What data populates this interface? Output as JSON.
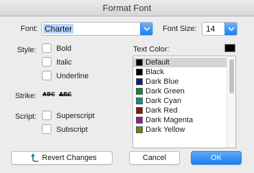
{
  "window": {
    "title": "Format Font"
  },
  "font": {
    "label": "Font:",
    "value": "Charter"
  },
  "font_size": {
    "label": "Font Size:",
    "value": "14"
  },
  "style": {
    "label": "Style:",
    "options": [
      {
        "label": "Bold",
        "checked": false
      },
      {
        "label": "Italic",
        "checked": false
      },
      {
        "label": "Underline",
        "checked": false
      }
    ]
  },
  "strike": {
    "label": "Strike:",
    "single_text": "ABC",
    "double_text": "ABC"
  },
  "script": {
    "label": "Script:",
    "options": [
      {
        "label": "Superscript",
        "checked": false
      },
      {
        "label": "Subscript",
        "checked": false
      }
    ]
  },
  "text_color": {
    "label": "Text Color:",
    "current_color": "#000000",
    "selected": "Default",
    "items": [
      {
        "name": "Default",
        "color": "#000000"
      },
      {
        "name": "Black",
        "color": "#000000"
      },
      {
        "name": "Dark Blue",
        "color": "#0b1f8a"
      },
      {
        "name": "Dark Green",
        "color": "#138a2c"
      },
      {
        "name": "Dark Cyan",
        "color": "#12908e"
      },
      {
        "name": "Dark Red",
        "color": "#8c1414"
      },
      {
        "name": "Dark Magenta",
        "color": "#8c208c"
      },
      {
        "name": "Dark Yellow",
        "color": "#7f7a14"
      }
    ]
  },
  "buttons": {
    "revert": "Revert Changes",
    "cancel": "Cancel",
    "ok": "OK"
  },
  "colors": {
    "accent": "#1b7ff2",
    "selection": "#b5d5fd"
  }
}
